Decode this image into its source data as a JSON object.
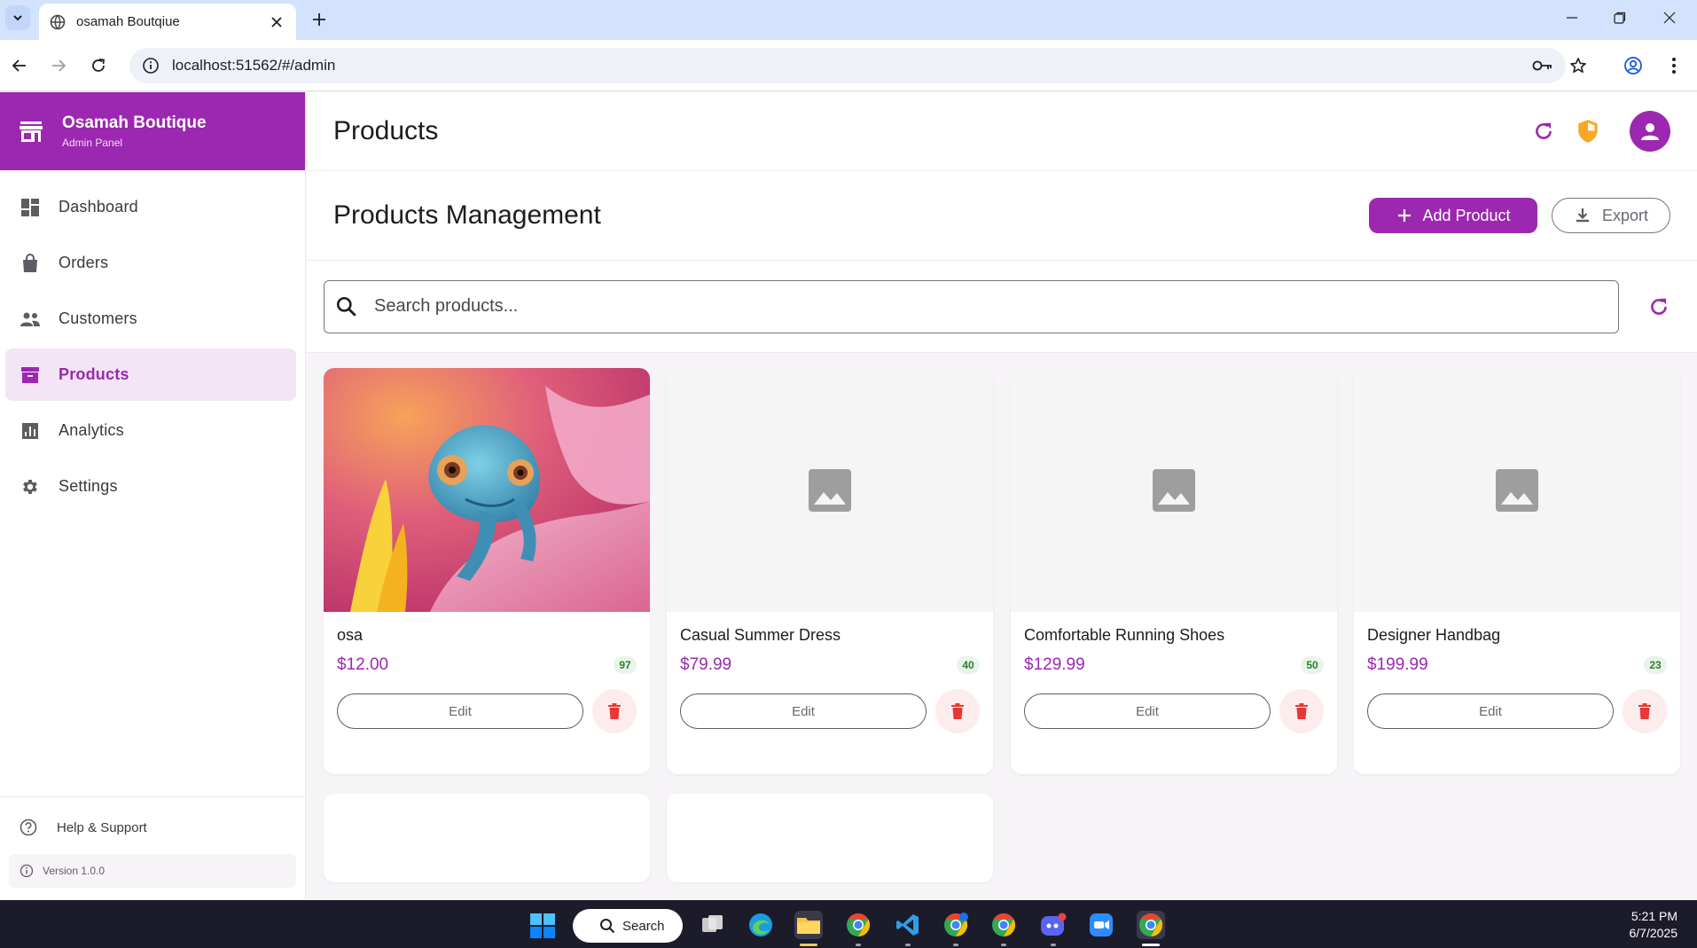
{
  "browser": {
    "tab_title": "osamah Boutqiue",
    "url": "localhost:51562/#/admin"
  },
  "sidebar": {
    "brand_name": "Osamah Boutique",
    "brand_sub": "Admin Panel",
    "items": [
      {
        "label": "Dashboard",
        "icon": "dashboard-icon"
      },
      {
        "label": "Orders",
        "icon": "shopping-bag-icon"
      },
      {
        "label": "Customers",
        "icon": "people-icon"
      },
      {
        "label": "Products",
        "icon": "inventory-icon",
        "active": true
      },
      {
        "label": "Analytics",
        "icon": "analytics-icon"
      },
      {
        "label": "Settings",
        "icon": "gear-icon"
      }
    ],
    "help_label": "Help & Support",
    "version_label": "Version 1.0.0"
  },
  "header": {
    "title": "Products"
  },
  "management": {
    "heading": "Products Management",
    "add_label": "Add Product",
    "export_label": "Export"
  },
  "search": {
    "placeholder": "Search products..."
  },
  "products": [
    {
      "name": "osa",
      "price": "$12.00",
      "stock": "97",
      "edit_label": "Edit",
      "has_image": true
    },
    {
      "name": "Casual Summer Dress",
      "price": "$79.99",
      "stock": "40",
      "edit_label": "Edit",
      "has_image": false
    },
    {
      "name": "Comfortable Running Shoes",
      "price": "$129.99",
      "stock": "50",
      "edit_label": "Edit",
      "has_image": false
    },
    {
      "name": "Designer Handbag",
      "price": "$199.99",
      "stock": "23",
      "edit_label": "Edit",
      "has_image": false
    }
  ],
  "taskbar": {
    "search_label": "Search",
    "time": "5:21 PM",
    "date": "6/7/2025"
  },
  "colors": {
    "primary": "#9c27b0",
    "primary_light": "#f3e5f5",
    "delete": "#e53935",
    "stock_green": "#2e7d32",
    "shield": "#f9a825"
  }
}
